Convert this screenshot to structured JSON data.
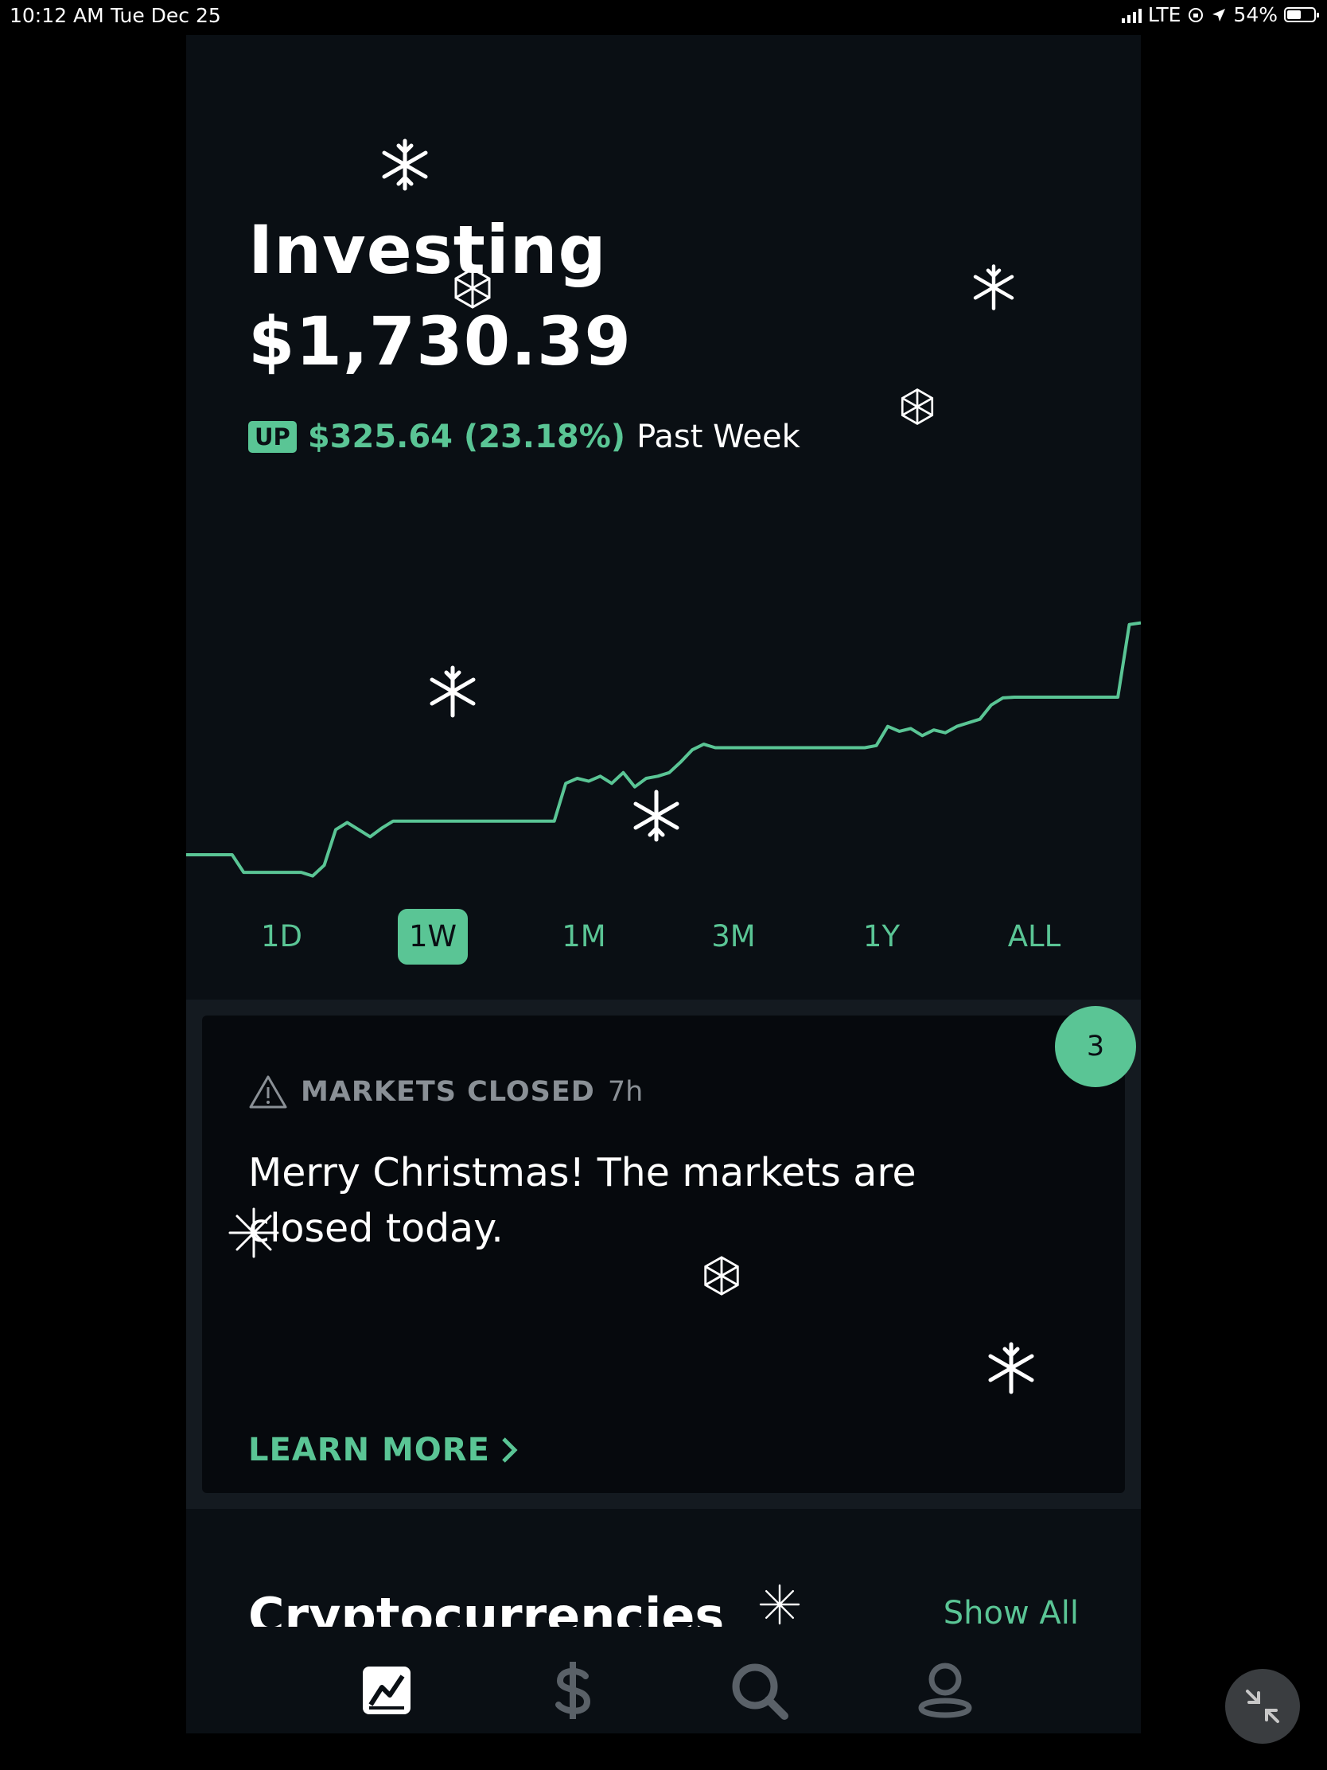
{
  "status_bar": {
    "time": "10:12 AM",
    "date": "Tue Dec 25",
    "network": "LTE",
    "battery": "54%",
    "battery_level": 0.54
  },
  "hero": {
    "title": "Investing",
    "value": "$1,730.39",
    "direction_badge": "UP",
    "change": "$325.64 (23.18%)",
    "period": "Past Week"
  },
  "colors": {
    "accent": "#5ac595",
    "background": "#0a0f14",
    "muted": "#8a9096"
  },
  "chart_data": {
    "type": "line",
    "title": "",
    "series": [
      {
        "values": [
          1404.75,
          1404.75,
          1404.75,
          1404.75,
          1404.75,
          1380,
          1380,
          1380,
          1380,
          1380,
          1380,
          1375,
          1390,
          1440,
          1450,
          1440,
          1430,
          1442,
          1452,
          1452,
          1452,
          1452,
          1452,
          1452,
          1452,
          1452,
          1452,
          1452,
          1452,
          1452,
          1452,
          1452,
          1452,
          1505,
          1512,
          1508,
          1515,
          1505,
          1520,
          1500,
          1512,
          1515,
          1520,
          1535,
          1552,
          1560,
          1555,
          1555,
          1555,
          1555,
          1555,
          1555,
          1555,
          1555,
          1555,
          1555,
          1555,
          1555,
          1555,
          1555,
          1558,
          1585,
          1578,
          1582,
          1572,
          1580,
          1576,
          1585,
          1590,
          1595,
          1615,
          1625,
          1626,
          1626,
          1626,
          1626,
          1626,
          1626,
          1626,
          1626,
          1626,
          1626,
          1728,
          1730.39
        ]
      }
    ],
    "ranges": [
      "1D",
      "1W",
      "1M",
      "3M",
      "1Y",
      "ALL"
    ],
    "active_range": "1W"
  },
  "notification_card": {
    "label": "MARKETS CLOSED",
    "age": "7h",
    "message": "Merry Christmas! The markets are closed today.",
    "link": "LEARN MORE",
    "count": "3"
  },
  "crypto_section": {
    "title": "Cryptocurrencies",
    "show_all": "Show All"
  },
  "tab_bar": {
    "tabs": [
      {
        "icon": "chart-icon",
        "active": true
      },
      {
        "icon": "dollar-icon",
        "active": false
      },
      {
        "icon": "search-icon",
        "active": false
      },
      {
        "icon": "account-icon",
        "active": false
      }
    ]
  },
  "overlay": {
    "icon": "minimize-icon"
  }
}
